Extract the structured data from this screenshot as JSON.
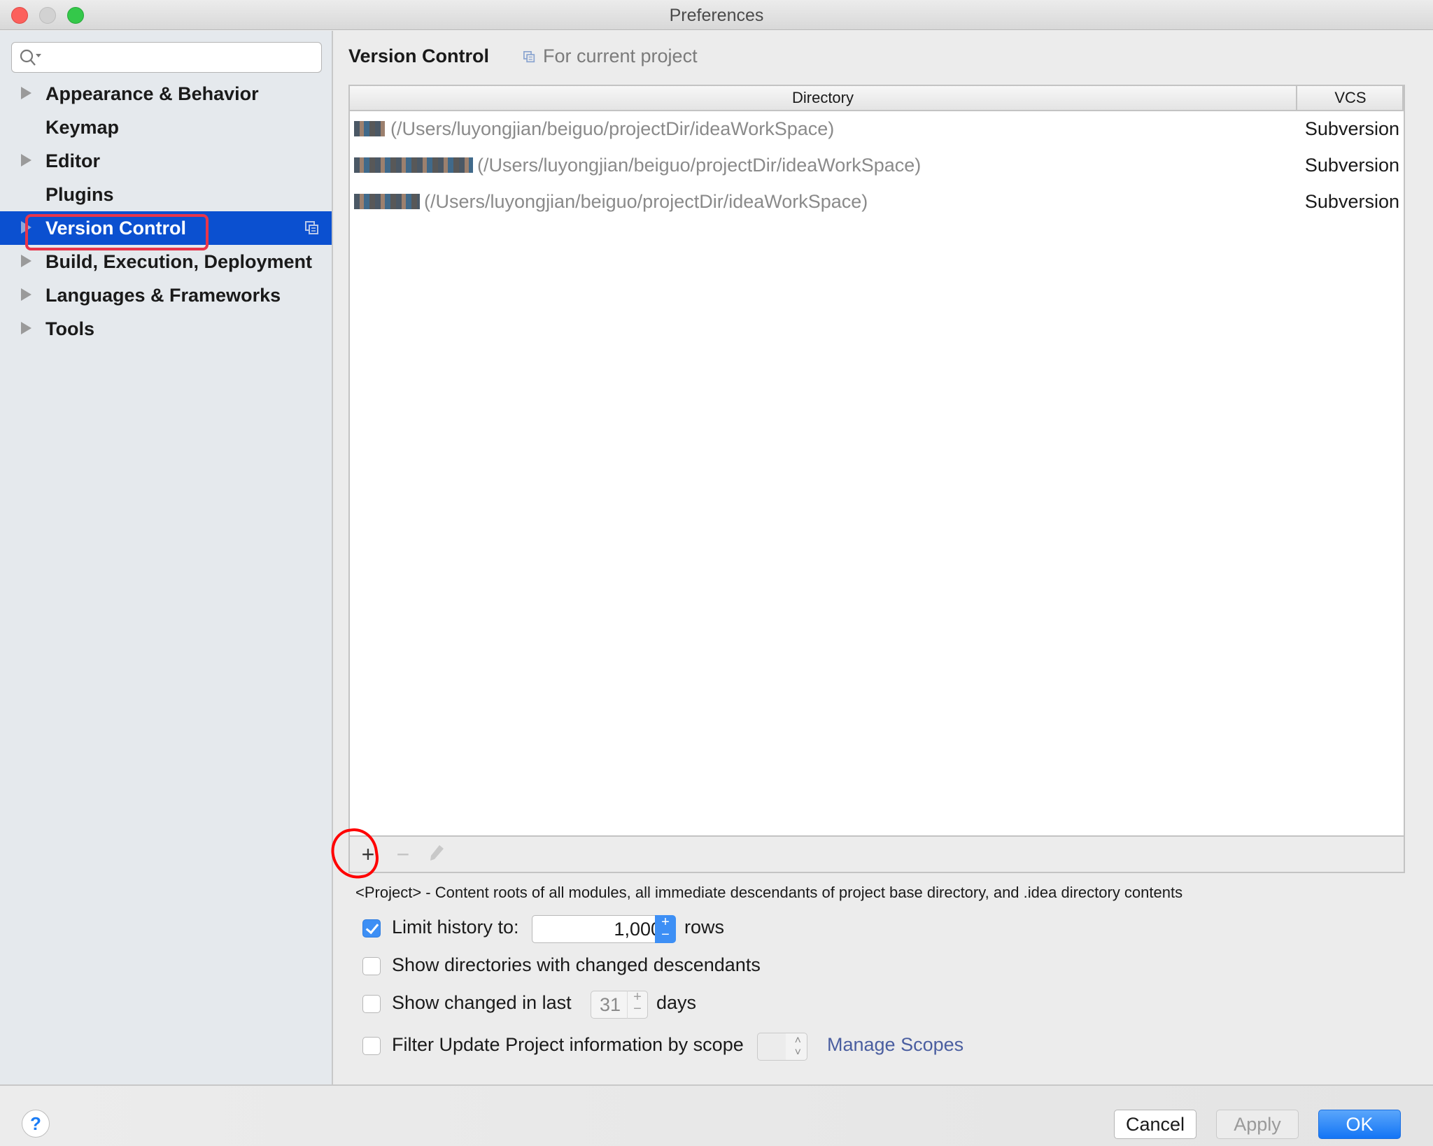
{
  "window": {
    "title": "Preferences"
  },
  "sidebar": {
    "search": {
      "value": "",
      "placeholder": ""
    },
    "items": [
      {
        "label": "Appearance & Behavior",
        "expandable": true,
        "selected": false
      },
      {
        "label": "Keymap",
        "expandable": false,
        "selected": false
      },
      {
        "label": "Editor",
        "expandable": true,
        "selected": false
      },
      {
        "label": "Plugins",
        "expandable": false,
        "selected": false
      },
      {
        "label": "Version Control",
        "expandable": true,
        "selected": true
      },
      {
        "label": "Build, Execution, Deployment",
        "expandable": true,
        "selected": false
      },
      {
        "label": "Languages & Frameworks",
        "expandable": true,
        "selected": false
      },
      {
        "label": "Tools",
        "expandable": true,
        "selected": false
      }
    ],
    "selection_color": "#0b50d0",
    "annotation_color": "#e8354a"
  },
  "main": {
    "title": "Version Control",
    "scope_label": "For current project",
    "table": {
      "columns": [
        "Directory",
        "VCS"
      ],
      "rows": [
        {
          "directory": "(/Users/luyongjian/beiguo/projectDir/ideaWorkSpace)",
          "vcs": "Subversion",
          "name_obscured": true
        },
        {
          "directory": "(/Users/luyongjian/beiguo/projectDir/ideaWorkSpace)",
          "vcs": "Subversion",
          "name_obscured": true
        },
        {
          "directory": "(/Users/luyongjian/beiguo/projectDir/ideaWorkSpace)",
          "vcs": "Subversion",
          "name_obscured": true
        }
      ]
    },
    "toolbar": {
      "add": "+",
      "remove": "−",
      "edit_icon": "pencil-icon"
    },
    "hint": "<Project> - Content roots of all modules, all immediate descendants of project base directory, and .idea directory contents",
    "options": {
      "limit_history": {
        "label": "Limit history to:",
        "checked": true,
        "value": "1,000",
        "suffix": "rows"
      },
      "show_dirs": {
        "label": "Show directories with changed descendants",
        "checked": false
      },
      "show_changed": {
        "label": "Show changed in last",
        "checked": false,
        "value": "31",
        "suffix": "days"
      },
      "filter_scope": {
        "label": "Filter Update Project information by scope",
        "checked": false,
        "value": "",
        "link": "Manage Scopes"
      }
    }
  },
  "footer": {
    "help": "?",
    "cancel": "Cancel",
    "apply": "Apply",
    "ok": "OK",
    "accent_color": "#1375f5"
  }
}
